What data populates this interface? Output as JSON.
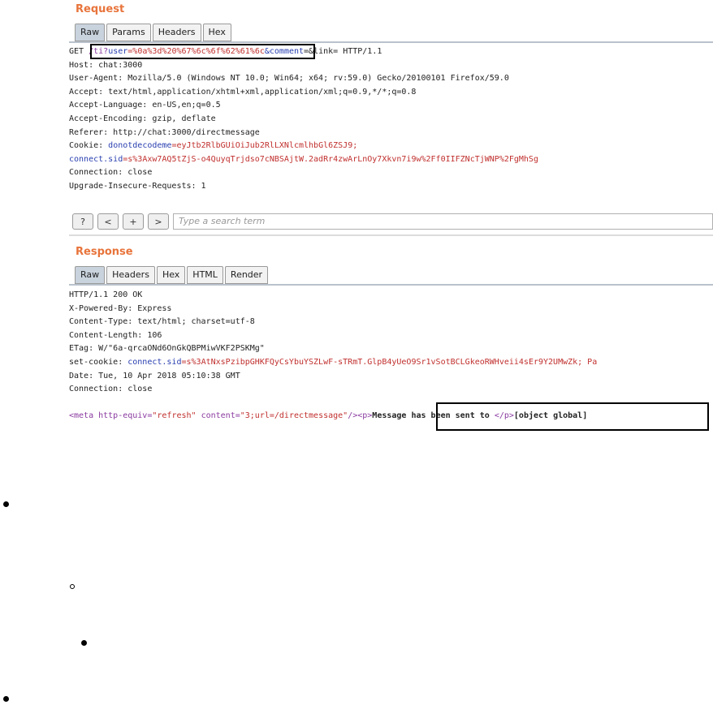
{
  "request": {
    "title": "Request",
    "tabs": [
      "Raw",
      "Params",
      "Headers",
      "Hex"
    ],
    "lines": {
      "l1_method": "GET ",
      "l1_path": "/ti?",
      "l1_param": "user",
      "l1_value": "=%0a%3d%20%67%6c%6f%62%61%6c",
      "l1_param2": "&comment",
      "l1_rest": "=&link= HTTP/1.1",
      "l2": "Host: chat:3000",
      "l3": "User-Agent: Mozilla/5.0 (Windows NT 10.0; Win64; x64; rv:59.0) Gecko/20100101 Firefox/59.0",
      "l4": "Accept: text/html,application/xhtml+xml,application/xml;q=0.9,*/*;q=0.8",
      "l5": "Accept-Language: en-US,en;q=0.5",
      "l6": "Accept-Encoding: gzip, deflate",
      "l7": "Referer: http://chat:3000/directmessage",
      "l8_key": "Cookie: ",
      "l8_name": "donotdecodeme",
      "l8_val": "=eyJtb2RlbGUiOiJub2RlLXNlcmlhbGl6ZSJ9;",
      "l9_name": "connect.sid",
      "l9_val": "=s%3Axw7AQ5tZjS-o4QuyqTrjdso7cNBSAjtW.2adRr4zwArLnOy7Xkvn7i9w%2Ff0IIFZNcTjWNP%2FgMhSg",
      "l10": "Connection: close",
      "l11": "Upgrade-Insecure-Requests: 1"
    }
  },
  "toolbar": {
    "help_label": "?",
    "prev_label": "<",
    "add_label": "+",
    "next_label": ">",
    "search_placeholder": "Type a search term"
  },
  "response": {
    "title": "Response",
    "tabs": [
      "Raw",
      "Headers",
      "Hex",
      "HTML",
      "Render"
    ],
    "lines": {
      "l1": "HTTP/1.1 200 OK",
      "l2": "X-Powered-By: Express",
      "l3": "Content-Type: text/html; charset=utf-8",
      "l4": "Content-Length: 106",
      "l5": "ETag: W/\"6a-qrcaONd6OnGkQBPMiwVKF2PSKMg\"",
      "l6_key": "set-cookie: ",
      "l6_name": "connect.sid",
      "l6_val": "=s%3AtNxsPzibpGHKFQyCsYbuYSZLwF-sTRmT.GlpB4yUeO9Sr1vSotBCLGkeoRWHveii4sEr9Y2UMwZk; Pa",
      "l7": "Date: Tue, 10 Apr 2018 05:10:38 GMT",
      "l8": "Connection: close",
      "l9_tag1": "<meta http-equiv=",
      "l9_str1": "\"refresh\"",
      "l9_attr": " content=",
      "l9_str2": "\"3;url=/directmessage\"",
      "l9_close": "/><p>",
      "l9_msg": "Message has been sent to ",
      "l9_endp": "</p>",
      "l9_obj": "[object global]"
    }
  }
}
